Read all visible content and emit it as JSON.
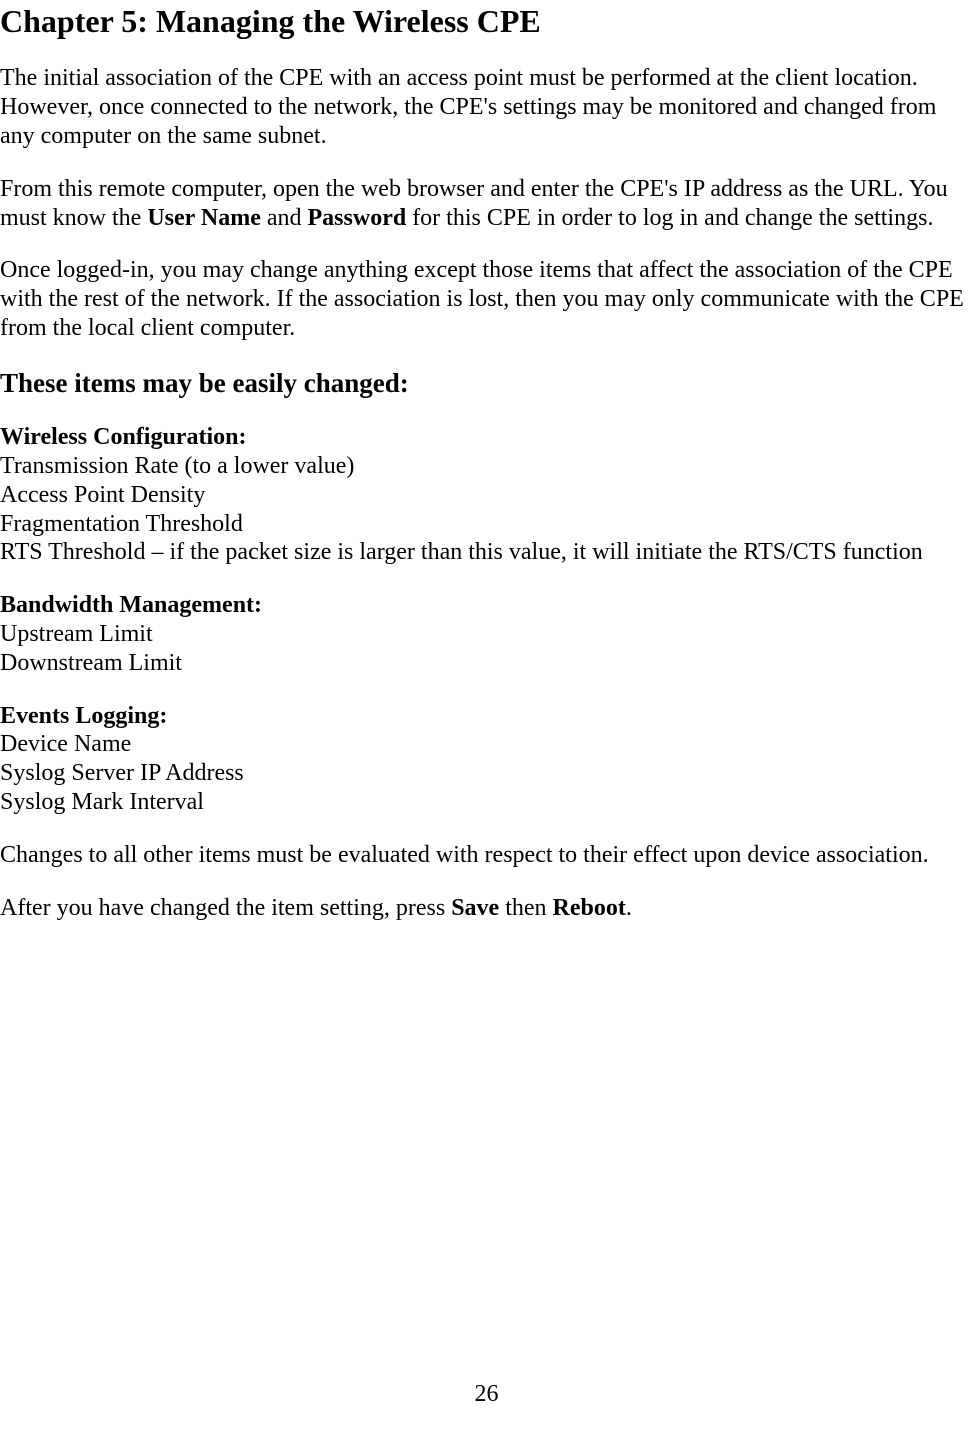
{
  "title": "Chapter 5: Managing the Wireless CPE",
  "para1": "The initial association of the CPE with an access point must be performed at the client location.  However, once connected to the network, the CPE's settings may be monitored and changed from any computer on the same subnet.",
  "para2_pre": "From this remote computer, open the web browser and enter the CPE's IP address as the URL.  You must know the ",
  "para2_bold1": "User Name",
  "para2_mid": " and ",
  "para2_bold2": "Password",
  "para2_post": " for this CPE in order to log in and change the settings.",
  "para3": "Once logged-in, you may change anything except those items that affect the association of the CPE with the rest of the network.  If the association is lost, then you may only communicate with the CPE from the local client computer.",
  "heading2": "These items may be easily changed:",
  "wireless": {
    "title": "Wireless Configuration:",
    "items": [
      "Transmission Rate (to a lower value)",
      "Access Point Density",
      "Fragmentation Threshold",
      "RTS Threshold – if the packet size is larger than this value, it will initiate the RTS/CTS function"
    ]
  },
  "bandwidth": {
    "title": "Bandwidth Management:",
    "items": [
      "Upstream Limit",
      "Downstream Limit"
    ]
  },
  "events": {
    "title": "Events Logging:",
    "items": [
      "Device Name",
      "Syslog Server IP Address",
      "Syslog Mark Interval"
    ]
  },
  "para4": "Changes to all other items must be evaluated with respect to their effect upon device association.",
  "para5_pre": "After you have changed the item setting, press ",
  "para5_bold1": "Save",
  "para5_mid": " then ",
  "para5_bold2": "Reboot",
  "para5_post": ".",
  "pageNumber": "26"
}
